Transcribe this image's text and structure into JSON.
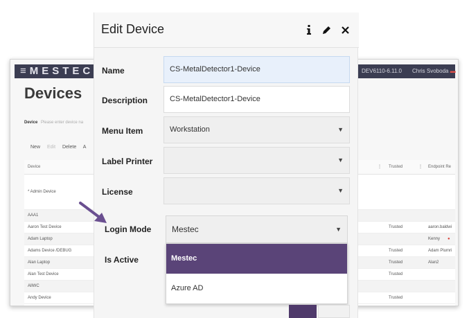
{
  "app": {
    "brand": "≡MESTEC",
    "version": "DEV6110-6.11.0",
    "user": "Chris Svoboda",
    "page_title": "Devices",
    "filter_label": "Device",
    "filter_placeholder": "Please enter device na",
    "toolbar": {
      "new": "New",
      "edit": "Edit",
      "delete": "Delete",
      "more": "A"
    },
    "columns": {
      "device": "Device",
      "trusted": "Trusted",
      "endpoint": "Endpoint Re"
    },
    "rows": [
      {
        "device": "* Admin Device",
        "trusted": "",
        "endpoint": ""
      },
      {
        "device": "AAA1",
        "trusted": "",
        "endpoint": ""
      },
      {
        "device": "Aaron Test Device",
        "trusted": "Trusted",
        "endpoint": "aaron.baldwi"
      },
      {
        "device": "Adam Laptop",
        "trusted": "",
        "endpoint": "Kenny"
      },
      {
        "device": "Adams Device /DEBUG",
        "trusted": "Trusted",
        "endpoint": "Adam Plumri"
      },
      {
        "device": "Alan Laptop",
        "trusted": "Trusted",
        "endpoint": "Alan2"
      },
      {
        "device": "Alan Test Device",
        "trusted": "Trusted",
        "endpoint": ""
      },
      {
        "device": "AllWC",
        "trusted": "",
        "endpoint": ""
      },
      {
        "device": "Andy Device",
        "trusted": "Trusted",
        "endpoint": ""
      }
    ]
  },
  "modal": {
    "title": "Edit Device",
    "icons": [
      "info-icon",
      "pencil-icon",
      "close-icon"
    ],
    "fields": {
      "name": {
        "label": "Name",
        "value": "CS-MetalDetector1-Device"
      },
      "description": {
        "label": "Description",
        "value": "CS-MetalDetector1-Device"
      },
      "menu_item": {
        "label": "Menu Item",
        "value": "Workstation"
      },
      "label_printer": {
        "label": "Label Printer",
        "value": ""
      },
      "license": {
        "label": "License",
        "value": ""
      },
      "login_mode": {
        "label": "Login Mode",
        "value": "Mestec",
        "options": [
          "Mestec",
          "Azure AD"
        ]
      },
      "is_active": {
        "label": "Is Active"
      }
    }
  },
  "colors": {
    "accent": "#5a4478",
    "topbar": "#3b3d52",
    "annotation_arrow": "#6a4f90"
  }
}
